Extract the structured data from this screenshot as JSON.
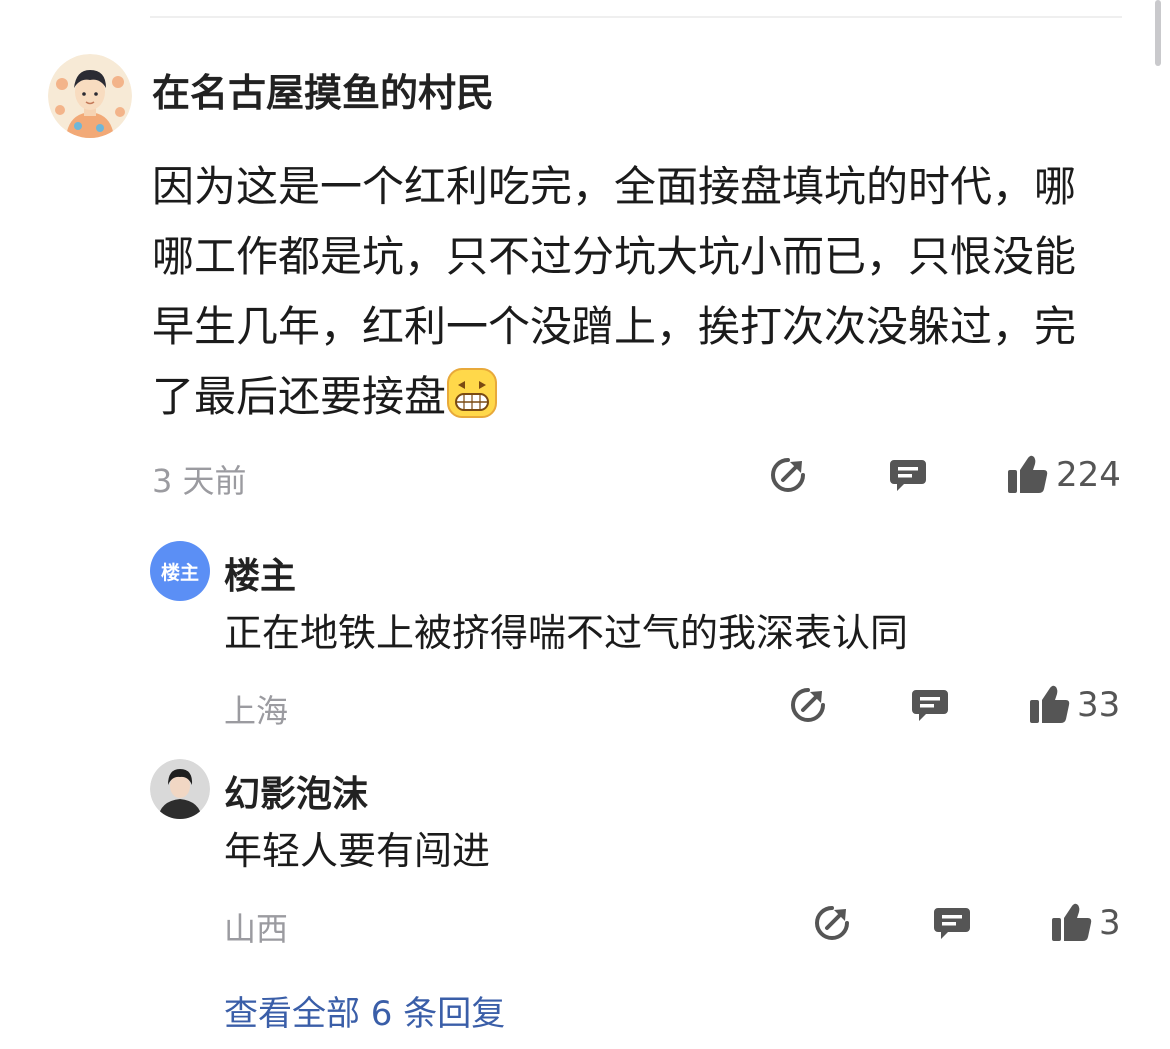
{
  "comment": {
    "author": "在名古屋摸鱼的村民",
    "text": "因为这是一个红利吃完，全面接盘填坑的时代，哪哪工作都是坑，只不过分坑大坑小而已，只恨没能早生几年，红利一个没蹭上，挨打次次没躲过，完了最后还要接盘",
    "time": "3 天前",
    "likes": "224"
  },
  "replies": [
    {
      "author": "楼主",
      "avatar_badge": "楼主",
      "text": "正在地铁上被挤得喘不过气的我深表认同",
      "location": "上海",
      "likes": "33"
    },
    {
      "author": "幻影泡沫",
      "text": "年轻人要有闯进",
      "location": "山西",
      "likes": "3"
    }
  ],
  "view_all": "查看全部 6 条回复",
  "colors": {
    "link": "#3a5ea8",
    "owner_badge": "#5b8ff5",
    "meta": "#9b9ba0"
  },
  "icons": {
    "share": "share-icon",
    "reply": "comment-icon",
    "like": "thumbs-up-icon"
  }
}
